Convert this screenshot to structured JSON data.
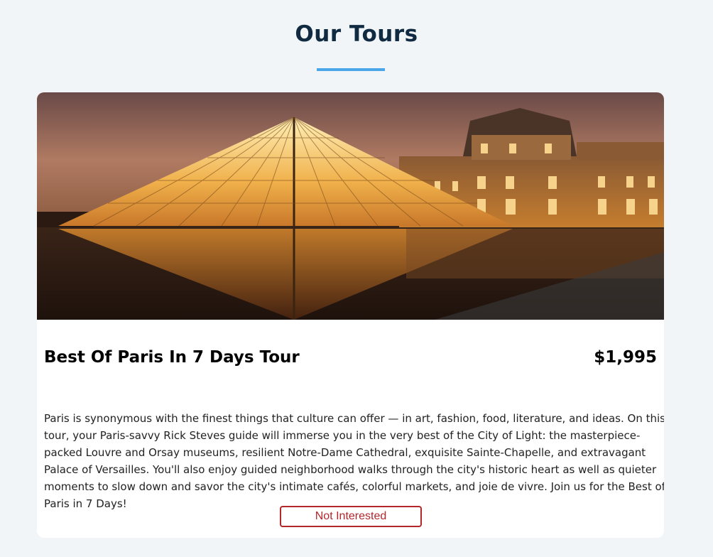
{
  "page": {
    "title": "Our Tours"
  },
  "colors": {
    "title": "#102a42",
    "underline": "#49a6e9",
    "button": "#b3272a",
    "background": "#f1f5f8"
  },
  "tour": {
    "image_description_icon": "louvre-pyramid-photo",
    "name": "Best Of Paris In 7 Days Tour",
    "price": "$1,995",
    "info": "Paris is synonymous with the finest things that culture can offer — in art, fashion, food, literature, and ideas. On this tour, your Paris-savvy Rick Steves guide will immerse you in the very best of the City of Light: the masterpiece-packed Louvre and Orsay museums, resilient Notre-Dame Cathedral, exquisite Sainte-Chapelle, and extravagant Palace of Versailles. You'll also enjoy guided neighborhood walks through the city's historic heart as well as quieter moments to slow down and savor the city's intimate cafés, colorful markets, and joie de vivre. Join us for the Best of Paris in 7 Days!",
    "button_label": "Not Interested"
  }
}
